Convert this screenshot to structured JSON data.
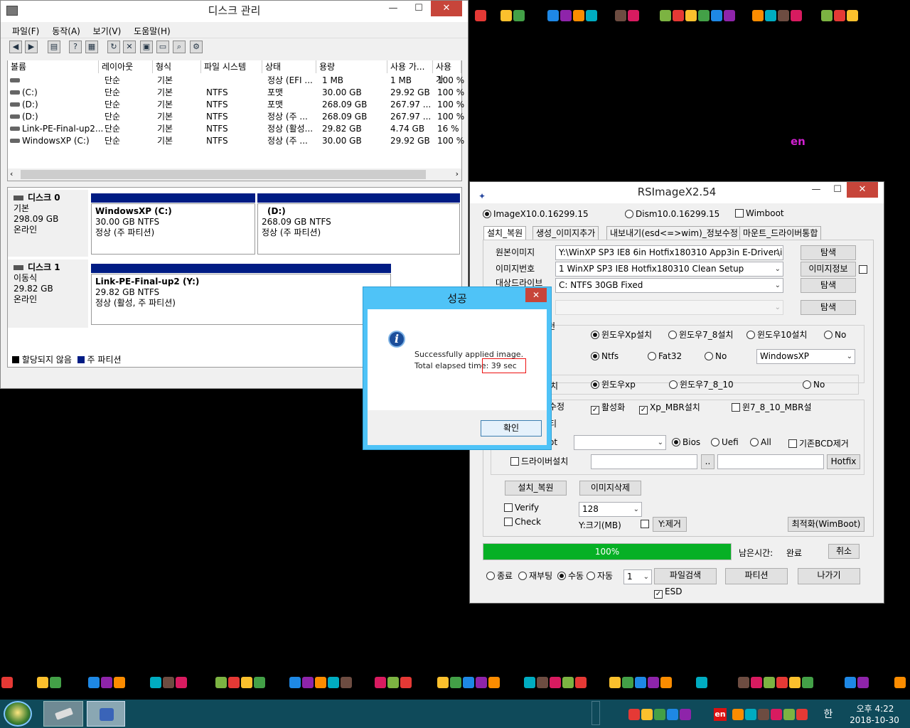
{
  "dm": {
    "title": "디스크 관리",
    "menu": [
      "파일(F)",
      "동작(A)",
      "보기(V)",
      "도움말(H)"
    ],
    "columns": [
      "볼륨",
      "레이아웃",
      "형식",
      "파일 시스템",
      "상태",
      "용량",
      "사용 가...",
      "사용 가"
    ],
    "rows": [
      {
        "vol": "",
        "layout": "단순",
        "type": "기본",
        "fs": "",
        "status": "정상 (EFI ...",
        "cap": "1 MB",
        "free": "1 MB",
        "pct": "100 %"
      },
      {
        "vol": "(C:)",
        "layout": "단순",
        "type": "기본",
        "fs": "NTFS",
        "status": "포맷",
        "cap": "30.00 GB",
        "free": "29.92 GB",
        "pct": "100 %"
      },
      {
        "vol": "(D:)",
        "layout": "단순",
        "type": "기본",
        "fs": "NTFS",
        "status": "포맷",
        "cap": "268.09 GB",
        "free": "267.97 ...",
        "pct": "100 %"
      },
      {
        "vol": "(D:)",
        "layout": "단순",
        "type": "기본",
        "fs": "NTFS",
        "status": "정상 (주 ...",
        "cap": "268.09 GB",
        "free": "267.97 ...",
        "pct": "100 %"
      },
      {
        "vol": "Link-PE-Final-up2...",
        "layout": "단순",
        "type": "기본",
        "fs": "NTFS",
        "status": "정상 (활성...",
        "cap": "29.82 GB",
        "free": "4.74 GB",
        "pct": "16 %"
      },
      {
        "vol": "WindowsXP (C:)",
        "layout": "단순",
        "type": "기본",
        "fs": "NTFS",
        "status": "정상 (주 ...",
        "cap": "30.00 GB",
        "free": "29.92 GB",
        "pct": "100 %"
      }
    ],
    "disk0": {
      "name": "디스크 0",
      "kind": "기본",
      "size": "298.09 GB",
      "state": "온라인",
      "p1": {
        "name": "WindowsXP  (C:)",
        "size": "30.00 GB NTFS",
        "status": "정상 (주 파티션)"
      },
      "p2": {
        "name": "(D:)",
        "size": "268.09 GB NTFS",
        "status": "정상 (주 파티션)"
      }
    },
    "disk1": {
      "name": "디스크 1",
      "kind": "이동식",
      "size": "29.82 GB",
      "state": "온라인",
      "p1": {
        "name": "Link-PE-Final-up2  (Y:)",
        "size": "29.82 GB NTFS",
        "status": "정상 (활성, 주 파티션)"
      }
    },
    "legend": {
      "unalloc": "할당되지 않음",
      "primary": "주 파티션"
    }
  },
  "dlg": {
    "title": "성공",
    "line1": "Successfully applied image.",
    "line2": "Total elapsed time: 39 sec",
    "ok": "확인"
  },
  "rs": {
    "title": "RSImageX2.54",
    "radio_imagex": "ImageX10.0.16299.15",
    "radio_dism": "Dism10.0.16299.15",
    "cb_wimboot": "Wimboot",
    "tabs": [
      "설치_복원",
      "생성_이미지추가",
      "내보내기(esd<=>wim)_정보수정",
      "마운트_드라이버통합"
    ],
    "lbl_src": "원본이미지",
    "src": "Y:\\WinXP SP3 IE8 6in Hotfix180310 App3in E-Driver\\ins",
    "lbl_idx": "이미지번호",
    "idx": "1  WinXP SP3 IE8 Hotfix180310 Clean Setup",
    "lbl_tgt": "대상드라이브",
    "tgt": "C:  NTFS            30GB  Fixed",
    "btn_browse": "탐색",
    "btn_info": "이미지정보",
    "lbl_row1_tail": "천",
    "os1": "윈도우Xp설치",
    "os2": "윈도우7_8설치",
    "os3": "윈도우10설치",
    "no": "No",
    "fs1": "Ntfs",
    "fs2": "Fat32",
    "fs_combo": "WindowsXP",
    "lbl_row3_tail": "치",
    "bt1": "윈도우xp",
    "bt2": "윈도우7_8_10",
    "lbl_row4_tail": "수정",
    "cb_active": "활성화",
    "cb_xpmbr": "Xp_MBR설치",
    "cb_w7mbr": "윈7_8_10_MBR설",
    "lbl_row5_tail": "티",
    "lbl_boot_tail": "ot",
    "bios": "Bios",
    "uefi": "Uefi",
    "all": "All",
    "cb_bcd": "기존BCD제거",
    "cb_driver": "드라이버설치",
    "btn_dots": "..",
    "btn_hotfix": "Hotfix",
    "btn_install": "설치_복원",
    "btn_delimg": "이미지삭제",
    "cb_verify": "Verify",
    "cb_check": "Check",
    "combo_128": "128",
    "lbl_ysize": "Y:크기(MB)",
    "btn_yremove": "Y:제거",
    "btn_optimize": "최적화(WimBoot)",
    "progress_text": "100%",
    "progress": 1.0,
    "lbl_remain": "남은시간:",
    "remain": "완료",
    "btn_cancel": "취소",
    "r_end": "종료",
    "r_reboot": "재부팅",
    "r_manual": "수동",
    "r_auto": "자동",
    "combo_1": "1",
    "btn_filesearch": "파일검색",
    "btn_partition": "파티션",
    "btn_exit": "나가기",
    "cb_esd": "ESD"
  },
  "desktop": {
    "lang": "en"
  },
  "taskbar": {
    "time": "오후 4:22",
    "date": "2018-10-30",
    "ime": "한",
    "lang": "en"
  },
  "colors": {
    "progress": "#06b025",
    "partition_header": "#001c84",
    "dialog_border": "#4fc3f7",
    "close": "#c7453a",
    "highlight": "#e11"
  }
}
